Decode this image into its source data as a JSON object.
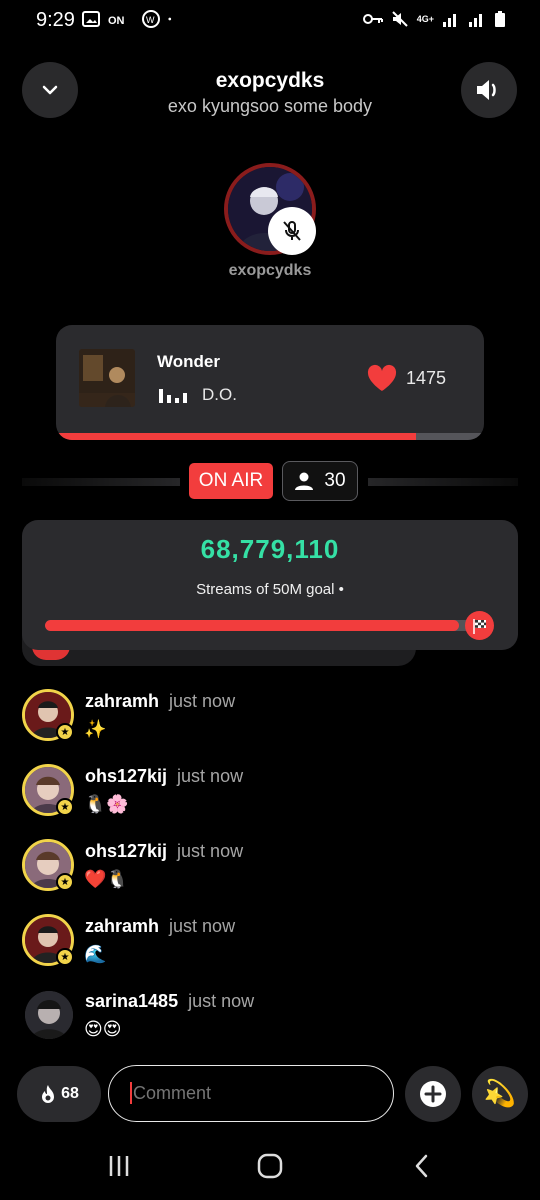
{
  "status_bar": {
    "time": "9:29",
    "network": "4G+"
  },
  "header": {
    "title": "exopcydks",
    "subtitle": "exo kyungsoo some body"
  },
  "host": {
    "name": "exopcydks"
  },
  "now_playing": {
    "title": "Wonder",
    "artist": "D.O.",
    "likes": "1475",
    "progress": 0.84
  },
  "live": {
    "on_air_label": "ON AIR",
    "listener_count": "30"
  },
  "goal": {
    "count": "68,779,110",
    "label": "Streams of 50M goal •",
    "progress": 0.94
  },
  "comments": [
    {
      "user": "zahramh",
      "time": "just now",
      "text": "✨",
      "badge": true
    },
    {
      "user": "ohs127kij",
      "time": "just now",
      "text": "🐧🌸",
      "badge": true
    },
    {
      "user": "ohs127kij",
      "time": "just now",
      "text": "❤️🐧",
      "badge": true
    },
    {
      "user": "zahramh",
      "time": "just now",
      "text": "🌊",
      "badge": true
    },
    {
      "user": "sarina1485",
      "time": "just now",
      "text": "😍😍",
      "badge": false
    }
  ],
  "composer": {
    "fire_count": "68",
    "placeholder": "Comment"
  },
  "colors": {
    "accent": "#f23d3d",
    "goal_text": "#35e0a5",
    "card": "#2b2b2e",
    "badge": "#f2d44a"
  }
}
